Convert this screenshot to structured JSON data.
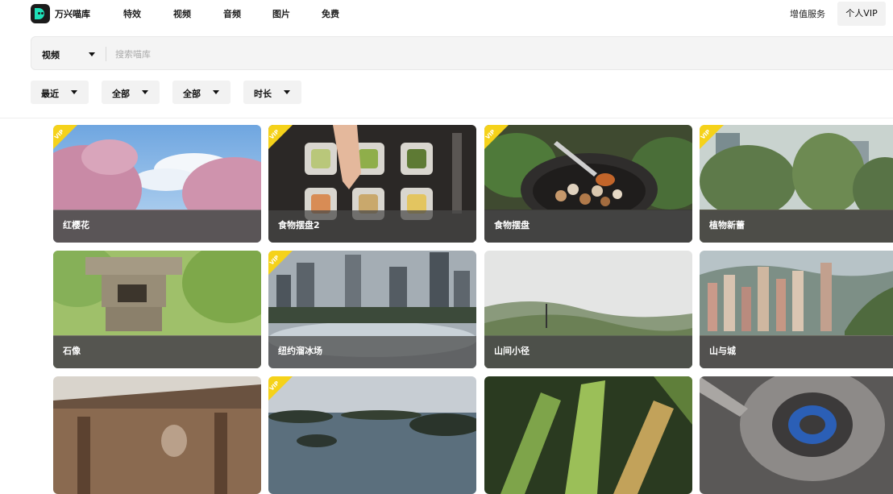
{
  "app": {
    "brand": "万兴喵库"
  },
  "nav": {
    "items": [
      {
        "label": "特效"
      },
      {
        "label": "视频"
      },
      {
        "label": "音频"
      },
      {
        "label": "图片"
      },
      {
        "label": "免费"
      }
    ],
    "value_added": "增值服务",
    "personal_vip": "个人VIP"
  },
  "search": {
    "type": "视频",
    "placeholder": "搜索喵库"
  },
  "filters": [
    {
      "label": "最近"
    },
    {
      "label": "全部"
    },
    {
      "label": "全部"
    },
    {
      "label": "时长"
    }
  ],
  "vip_tag": "VIP",
  "cards": [
    {
      "title": "红樱花",
      "vip": true
    },
    {
      "title": "食物摆盘2",
      "vip": true
    },
    {
      "title": "食物摆盘",
      "vip": true
    },
    {
      "title": "植物新蕾",
      "vip": true
    },
    {
      "title": "石像",
      "vip": false
    },
    {
      "title": "纽约溜冰场",
      "vip": true
    },
    {
      "title": "山间小径",
      "vip": false
    },
    {
      "title": "山与城",
      "vip": false
    },
    {
      "title": "",
      "vip": false
    },
    {
      "title": "",
      "vip": true
    },
    {
      "title": "",
      "vip": false
    },
    {
      "title": "",
      "vip": false
    }
  ],
  "colors": {
    "vip_tag": "#f5d21a",
    "brand_accent": "#1ee0b8"
  }
}
